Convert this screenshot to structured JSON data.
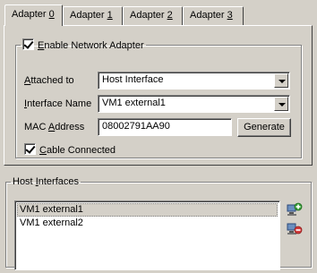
{
  "tabs": [
    {
      "label_pre": "Adapter ",
      "label_acc": "0",
      "active": true
    },
    {
      "label_pre": "Adapter ",
      "label_acc": "1",
      "active": false
    },
    {
      "label_pre": "Adapter ",
      "label_acc": "2",
      "active": false
    },
    {
      "label_pre": "Adapter ",
      "label_acc": "3",
      "active": false
    }
  ],
  "adapter": {
    "enable_label_acc": "E",
    "enable_label_rest": "nable Network Adapter",
    "enable_checked": true,
    "attached_label_acc": "A",
    "attached_label_rest": "ttached to",
    "attached_value": "Host Interface",
    "iface_label_acc": "I",
    "iface_label_rest": "nterface Name",
    "iface_value": "VM1 external1",
    "mac_label_pre": "MAC ",
    "mac_label_acc": "A",
    "mac_label_rest": "ddress",
    "mac_value": "08002791AA90",
    "generate_label": "Generate",
    "cable_label_pre": "",
    "cable_label_acc": "C",
    "cable_label_rest": "able Connected",
    "cable_checked": true
  },
  "host_interfaces": {
    "title_pre": "Host ",
    "title_acc": "I",
    "title_rest": "nterfaces",
    "items": [
      "VM1 external1",
      "VM1 external2"
    ],
    "selected_index": 0,
    "add_icon": "add-interface-icon",
    "remove_icon": "remove-interface-icon"
  }
}
